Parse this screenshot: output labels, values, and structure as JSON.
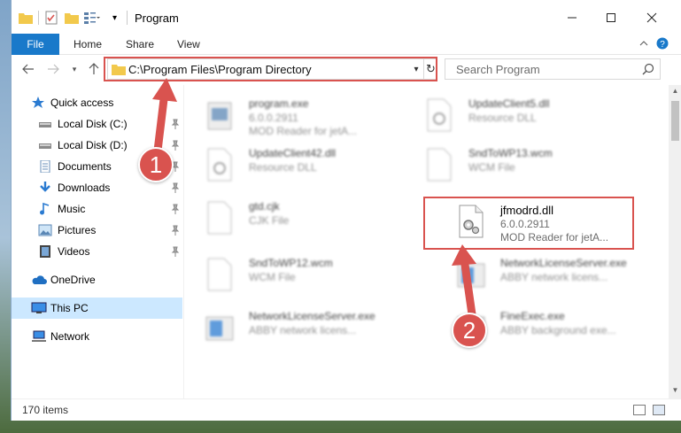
{
  "window": {
    "title": "Program"
  },
  "ribbon": {
    "tabs": [
      "File",
      "Home",
      "Share",
      "View"
    ]
  },
  "address": {
    "path": "C:\\Program Files\\Program Directory",
    "search_placeholder": "Search Program"
  },
  "sidebar": {
    "items": [
      {
        "label": "Quick access",
        "icon": "star-icon"
      },
      {
        "label": "Local Disk (C:)",
        "icon": "drive-icon"
      },
      {
        "label": "Local Disk (D:)",
        "icon": "drive-icon"
      },
      {
        "label": "Documents",
        "icon": "documents-icon"
      },
      {
        "label": "Downloads",
        "icon": "download-icon"
      },
      {
        "label": "Music",
        "icon": "music-icon"
      },
      {
        "label": "Pictures",
        "icon": "pictures-icon"
      },
      {
        "label": "Videos",
        "icon": "videos-icon"
      },
      {
        "label": "OneDrive",
        "icon": "cloud-icon"
      },
      {
        "label": "This PC",
        "icon": "computer-icon"
      },
      {
        "label": "Network",
        "icon": "network-icon"
      }
    ]
  },
  "files": [
    {
      "name": "program.exe",
      "line2": "6.0.0.2911",
      "line3": "MOD Reader for jetA..."
    },
    {
      "name": "UpdateClient5.dll",
      "line2": "Resource DLL",
      "line3": ""
    },
    {
      "name": "UpdateClient42.dll",
      "line2": "Resource DLL",
      "line3": ""
    },
    {
      "name": "SndToWP13.wcm",
      "line2": "WCM File",
      "line3": ""
    },
    {
      "name": "gtd.cjk",
      "line2": "CJK File",
      "line3": ""
    },
    {
      "name": "jfmodrd.dll",
      "line2": "6.0.0.2911",
      "line3": "MOD Reader for jetA..."
    },
    {
      "name": "SndToWP12.wcm",
      "line2": "WCM File",
      "line3": ""
    },
    {
      "name": "NetworkLicenseServer.exe",
      "line2": "ABBY network licens...",
      "line3": ""
    },
    {
      "name": "NetworkLicenseServer.exe",
      "line2": "ABBY network licens...",
      "line3": ""
    },
    {
      "name": "FineExec.exe",
      "line2": "ABBY background exe...",
      "line3": ""
    }
  ],
  "status": {
    "item_count": "170 items"
  },
  "callouts": [
    "1",
    "2"
  ],
  "colors": {
    "accent": "#1979ca",
    "highlight": "#d9534f",
    "selected": "#cce8ff"
  }
}
